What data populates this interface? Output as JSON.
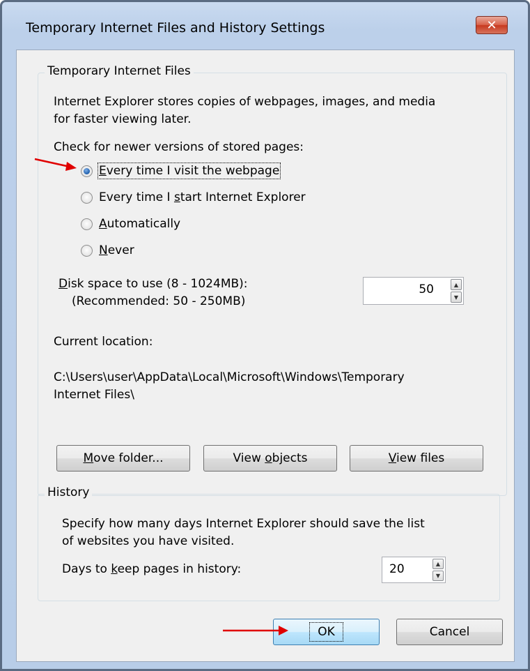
{
  "window": {
    "title": "Temporary Internet Files and History Settings",
    "close_label": "x"
  },
  "tif": {
    "group_label": "Temporary Internet Files",
    "desc_line1": "Internet Explorer stores copies of webpages, images, and media",
    "desc_line2": "for faster viewing later.",
    "check_label": "Check for newer versions of stored pages:",
    "options": [
      {
        "label": "Every time I visit the webpage",
        "checked": true
      },
      {
        "label": "Every time I start Internet Explorer",
        "checked": false
      },
      {
        "label": "Automatically",
        "checked": false
      },
      {
        "label": "Never",
        "checked": false
      }
    ],
    "disk_label_line1": "Disk space to use (8 - 1024MB):",
    "disk_label_line2": "(Recommended: 50 - 250MB)",
    "disk_value": "50",
    "location_label": "Current location:",
    "location_line1": "C:\\Users\\user\\AppData\\Local\\Microsoft\\Windows\\Temporary",
    "location_line2": "Internet Files\\",
    "buttons": {
      "move_folder": "Move folder...",
      "view_objects": "View objects",
      "view_files": "View files"
    }
  },
  "history": {
    "group_label": "History",
    "desc_line1": "Specify how many days Internet Explorer should save the list",
    "desc_line2": "of websites you have visited.",
    "days_label": "Days to keep pages in history:",
    "days_value": "20"
  },
  "footer": {
    "ok_label": "OK",
    "cancel_label": "Cancel"
  },
  "annotations": {
    "arrow_color": "#e00000"
  }
}
